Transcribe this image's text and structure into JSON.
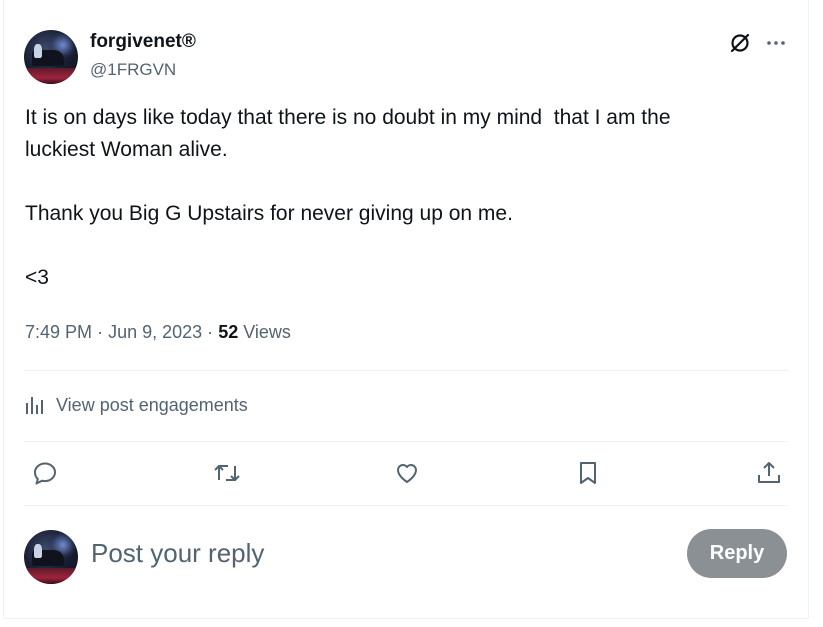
{
  "author": {
    "display_name": "forgivenet®",
    "handle": "@1FRGVN",
    "avatar": "avatar-pianist"
  },
  "post": {
    "lines": [
      "It is on days like today that there is no doubt in my mind  that I am the",
      "luckiest Woman alive.",
      "Thank you Big G Upstairs for never giving up on me.",
      "<3"
    ],
    "time": "7:49 PM",
    "date": "Jun 9, 2023",
    "separator": "·",
    "views_count": "52",
    "views_label": "Views"
  },
  "engagements": {
    "label": "View post engagements",
    "icon": "bar-chart-icon"
  },
  "actions": [
    {
      "name": "reply",
      "icon": "reply-icon"
    },
    {
      "name": "repost",
      "icon": "repost-icon"
    },
    {
      "name": "like",
      "icon": "heart-icon"
    },
    {
      "name": "bookmark",
      "icon": "bookmark-icon"
    },
    {
      "name": "share",
      "icon": "share-icon"
    }
  ],
  "header_icons": [
    "grok-icon",
    "more-icon"
  ],
  "composer": {
    "placeholder": "Post your reply",
    "button_label": "Reply"
  },
  "colors": {
    "text": "#0f1419",
    "secondary": "#536471",
    "divider": "#eff3f4",
    "reply_button_disabled": "#8b9095"
  }
}
